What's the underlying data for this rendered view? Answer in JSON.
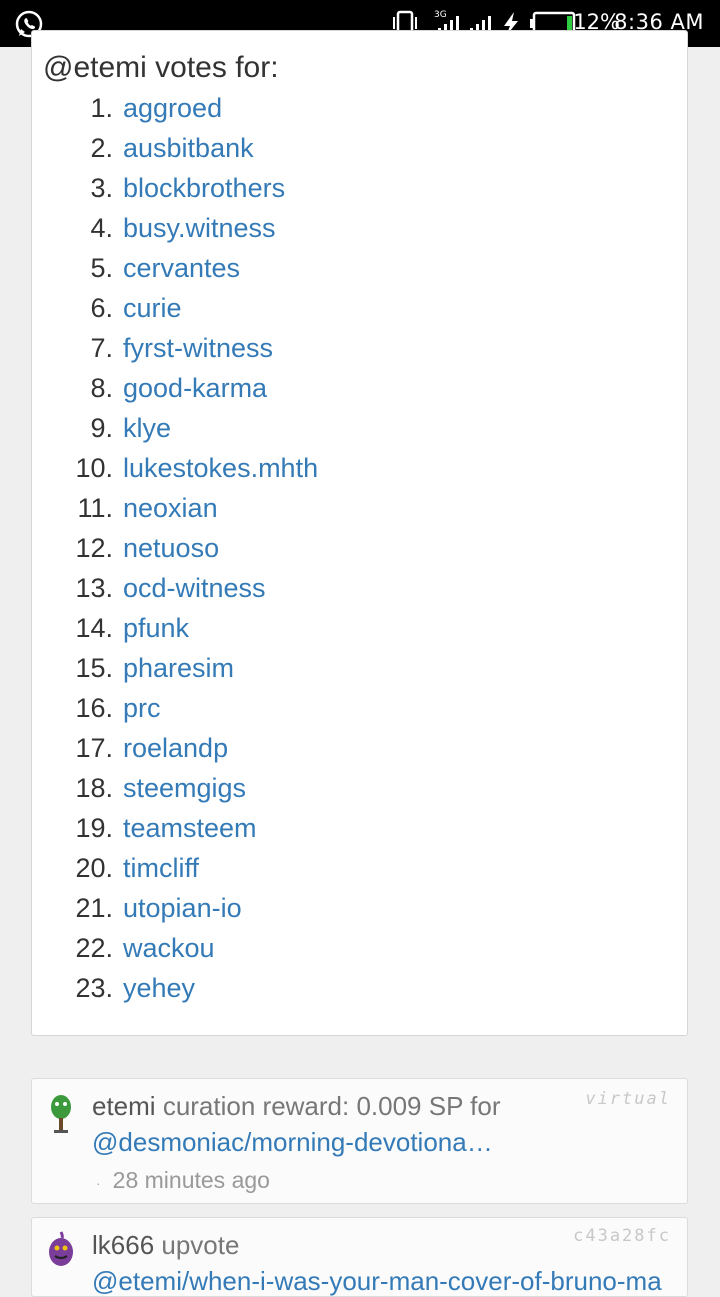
{
  "status_bar": {
    "network": "3G",
    "battery_percent": "12%",
    "time": "8:36 AM",
    "colors": {
      "background": "#000000",
      "battery_fill": "#2ecc40"
    }
  },
  "votes": {
    "heading": "@etemi votes for:",
    "items": [
      {
        "num": "1.",
        "name": "aggroed"
      },
      {
        "num": "2.",
        "name": "ausbitbank"
      },
      {
        "num": "3.",
        "name": "blockbrothers"
      },
      {
        "num": "4.",
        "name": "busy.witness"
      },
      {
        "num": "5.",
        "name": "cervantes"
      },
      {
        "num": "6.",
        "name": "curie"
      },
      {
        "num": "7.",
        "name": "fyrst-witness"
      },
      {
        "num": "8.",
        "name": "good-karma"
      },
      {
        "num": "9.",
        "name": "klye"
      },
      {
        "num": "10.",
        "name": "lukestokes.mhth"
      },
      {
        "num": "11.",
        "name": "neoxian"
      },
      {
        "num": "12.",
        "name": "netuoso"
      },
      {
        "num": "13.",
        "name": "ocd-witness"
      },
      {
        "num": "14.",
        "name": "pfunk"
      },
      {
        "num": "15.",
        "name": "pharesim"
      },
      {
        "num": "16.",
        "name": "prc"
      },
      {
        "num": "17.",
        "name": "roelandp"
      },
      {
        "num": "18.",
        "name": "steemgigs"
      },
      {
        "num": "19.",
        "name": "teamsteem"
      },
      {
        "num": "20.",
        "name": "timcliff"
      },
      {
        "num": "21.",
        "name": "utopian-io"
      },
      {
        "num": "22.",
        "name": "wackou"
      },
      {
        "num": "23.",
        "name": "yehey"
      }
    ],
    "link_color": "#337ab7"
  },
  "activities": [
    {
      "user": "etemi",
      "action": "curation reward: 0.009 SP for",
      "link": "@desmoniac/morning-devotiona…",
      "time": "28 minutes ago",
      "tag": "virtual",
      "avatar_color": "#3c9a3c"
    },
    {
      "user": "lk666",
      "action": "upvote",
      "link": "@etemi/when-i-was-your-man-cover-of-bruno-ma",
      "tag": "c43a28fc",
      "avatar_color": "#7a3d99"
    }
  ]
}
